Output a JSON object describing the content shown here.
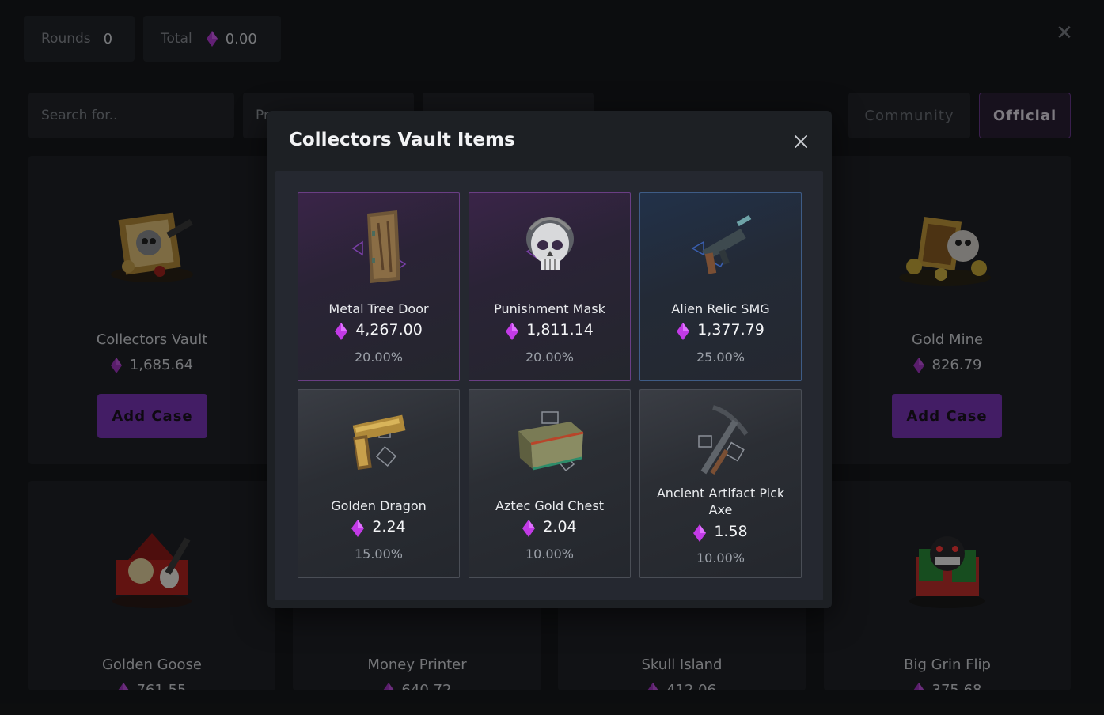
{
  "header": {
    "rounds_label": "Rounds",
    "rounds_value": "0",
    "total_label": "Total",
    "total_value": "0.00"
  },
  "filters": {
    "search_placeholder": "Search for..",
    "filter1_label": "Pr",
    "community_tab": "Community",
    "official_tab": "Official"
  },
  "cases": [
    {
      "name": "Collectors Vault",
      "price": "1,685.64",
      "button": "Add Case"
    },
    {
      "name": "Gold Mine",
      "price": "826.79",
      "button": "Add Case"
    },
    {
      "name": "Golden Goose",
      "price": "761.55"
    },
    {
      "name": "Money Printer",
      "price": "640.72"
    },
    {
      "name": "Skull Island",
      "price": "412.06"
    },
    {
      "name": "Big Grin Flip",
      "price": "375.68"
    }
  ],
  "modal": {
    "title": "Collectors Vault Items",
    "items": [
      {
        "name": "Metal Tree Door",
        "price": "4,267.00",
        "odds": "20.00%",
        "rarity": "legendary",
        "icon": "door-icon"
      },
      {
        "name": "Punishment Mask",
        "price": "1,811.14",
        "odds": "20.00%",
        "rarity": "legendary",
        "icon": "skull-mask-icon"
      },
      {
        "name": "Alien Relic SMG",
        "price": "1,377.79",
        "odds": "25.00%",
        "rarity": "epic",
        "icon": "smg-icon"
      },
      {
        "name": "Golden Dragon",
        "price": "2.24",
        "odds": "15.00%",
        "rarity": "normal",
        "icon": "pistol-icon"
      },
      {
        "name": "Aztec Gold Chest",
        "price": "2.04",
        "odds": "10.00%",
        "rarity": "normal",
        "icon": "chest-icon"
      },
      {
        "name": "Ancient Artifact Pick Axe",
        "price": "1.58",
        "odds": "10.00%",
        "rarity": "normal",
        "icon": "pickaxe-icon"
      }
    ]
  },
  "colors": {
    "gem": "#c23ae6",
    "accent": "#7a35b8"
  }
}
